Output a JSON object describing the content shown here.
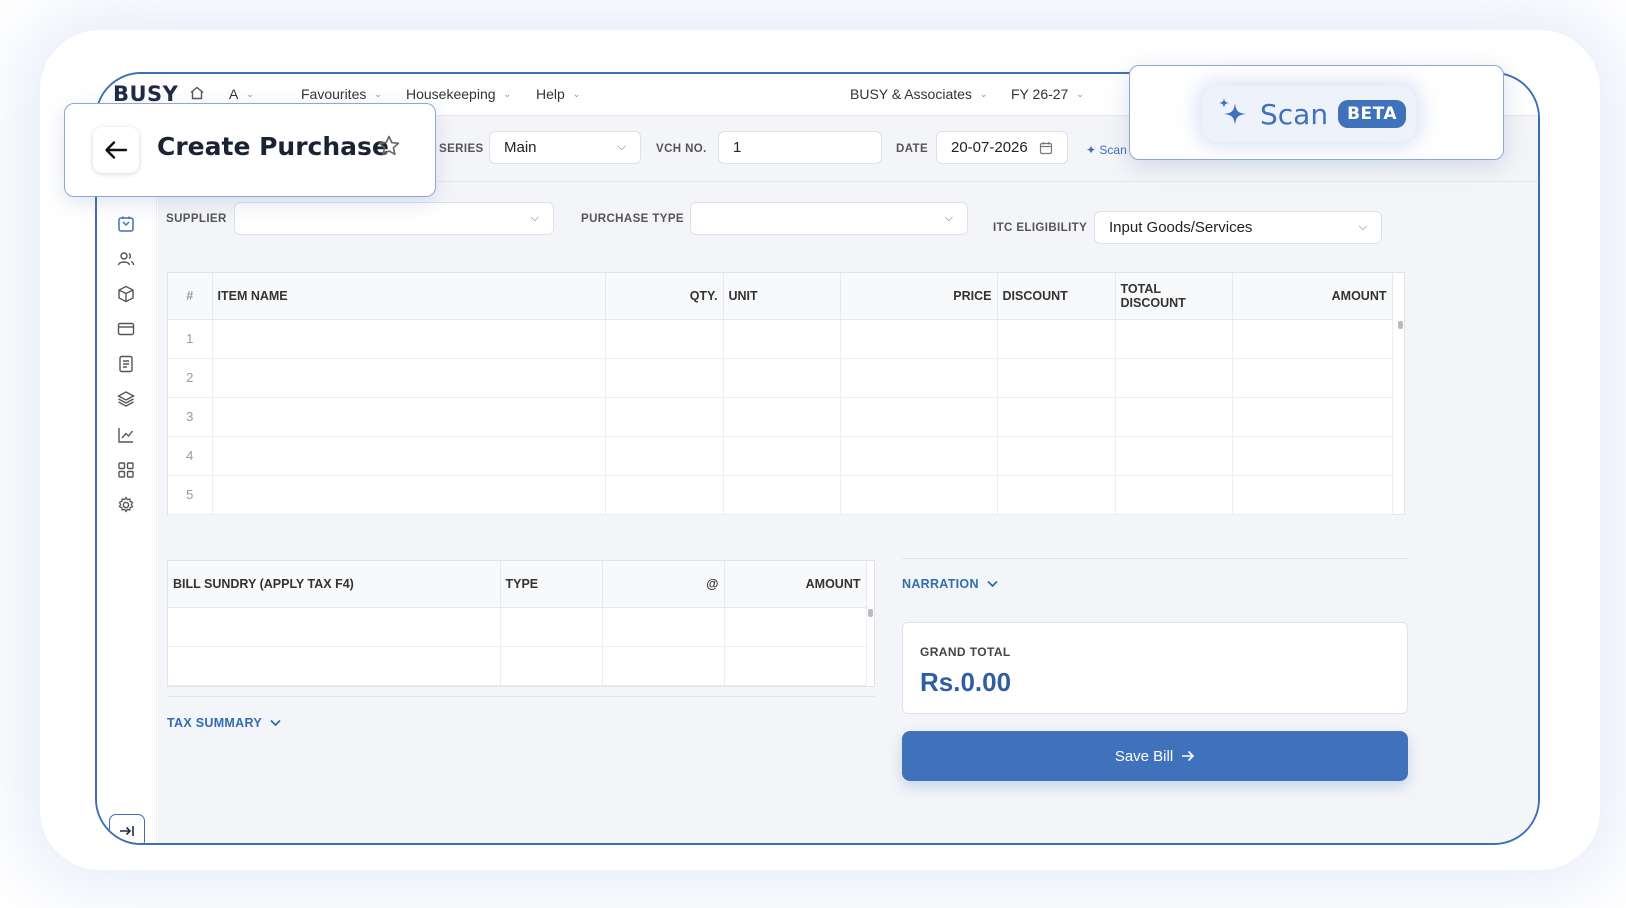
{
  "topbar": {
    "logo": "BUSY",
    "company_switcher": "A",
    "menus": [
      "Favourites",
      "Housekeeping",
      "Help"
    ],
    "company_name": "BUSY & Associates",
    "fiscal_year": "FY 26-27"
  },
  "header": {
    "title": "Create Purchase",
    "series_label": "SERIES",
    "series_value": "Main",
    "vch_label": "VCH NO.",
    "vch_value": "1",
    "date_label": "DATE",
    "date_value": "20-07-2026",
    "scan_inline": "Scan"
  },
  "scan_callout": {
    "label": "Scan",
    "badge": "BETA"
  },
  "form": {
    "supplier_label": "SUPPLIER",
    "supplier_value": "",
    "purchase_type_label": "PURCHASE TYPE",
    "purchase_type_value": "",
    "itc_label": "ITC ELIGIBILITY",
    "itc_value": "Input Goods/Services"
  },
  "items_table": {
    "columns": [
      "#",
      "ITEM NAME",
      "QTY.",
      "UNIT",
      "PRICE",
      "DISCOUNT",
      "TOTAL DISCOUNT",
      "AMOUNT"
    ],
    "rows": [
      "1",
      "2",
      "3",
      "4",
      "5"
    ]
  },
  "bill_sundry_table": {
    "columns": [
      "BILL SUNDRY (APPLY TAX F4)",
      "TYPE",
      "@",
      "AMOUNT"
    ]
  },
  "tax_summary_label": "TAX SUMMARY",
  "narration_label": "NARRATION",
  "grand_total": {
    "label": "GRAND TOTAL",
    "value": "Rs.0.00"
  },
  "save_button": "Save Bill",
  "sidebar_icons": [
    "purchase-icon",
    "users-icon",
    "box-icon",
    "card-icon",
    "document-icon",
    "layers-icon",
    "chart-icon",
    "grid-icon",
    "settings-icon"
  ],
  "colors": {
    "accent": "#3f72bb",
    "border": "#3d6fb8",
    "total": "#2f5ea3"
  }
}
